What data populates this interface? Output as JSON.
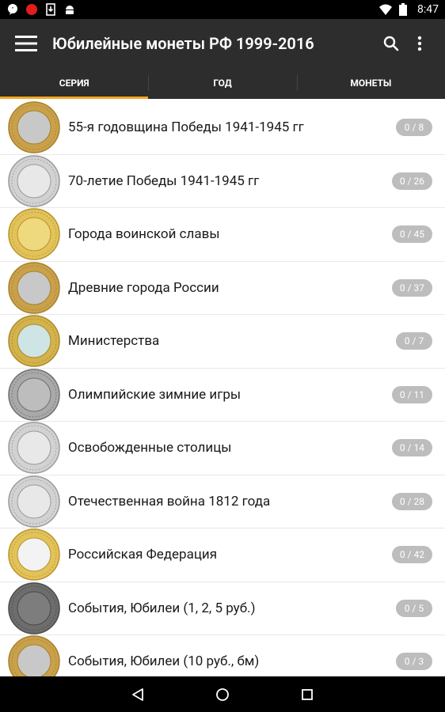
{
  "status_bar": {
    "time": "8:47",
    "icons": [
      "chat-bubble-icon",
      "record-dot-icon",
      "download-icon",
      "android-icon",
      "wifi-icon",
      "battery-icon"
    ]
  },
  "toolbar": {
    "title": "Юбилейные монеты РФ 1999-2016",
    "menu_icon": "hamburger-menu-icon",
    "search_icon": "search-icon",
    "overflow_icon": "more-vert-icon"
  },
  "tabs": [
    {
      "label": "СЕРИЯ",
      "active": true
    },
    {
      "label": "ГОД",
      "active": false
    },
    {
      "label": "МОНЕТЫ",
      "active": false
    }
  ],
  "series": [
    {
      "label": "55-я годовщина Победы 1941-1945 гг",
      "count": "0 / 8",
      "coin": "bimetal"
    },
    {
      "label": "70-летие Победы 1941-1945 гг",
      "count": "0 / 26",
      "coin": "silver"
    },
    {
      "label": "Города воинской славы",
      "count": "0 / 45",
      "coin": "gold"
    },
    {
      "label": "Древние города России",
      "count": "0 / 37",
      "coin": "bimetal"
    },
    {
      "label": "Министерства",
      "count": "0 / 7",
      "coin": "bimetal-blue"
    },
    {
      "label": "Олимпийские зимние игры",
      "count": "0 / 11",
      "coin": "silver-dark"
    },
    {
      "label": "Освобожденные столицы",
      "count": "0 / 14",
      "coin": "silver"
    },
    {
      "label": "Отечественная война 1812 года",
      "count": "0 / 28",
      "coin": "silver"
    },
    {
      "label": "Российская Федерация",
      "count": "0 / 42",
      "coin": "gold-white"
    },
    {
      "label": "События, Юбилеи (1, 2, 5 руб.)",
      "count": "0 / 5",
      "coin": "dark"
    },
    {
      "label": "События, Юбилеи (10 руб., бм)",
      "count": "0 / 3",
      "coin": "bimetal"
    }
  ],
  "nav_bar": {
    "back_icon": "back-triangle-icon",
    "home_icon": "home-circle-icon",
    "recents_icon": "recents-square-icon"
  },
  "colors": {
    "toolbar_bg": "#2d2d2d",
    "tab_indicator": "#f5a623",
    "badge_bg": "#bdbdbd"
  }
}
